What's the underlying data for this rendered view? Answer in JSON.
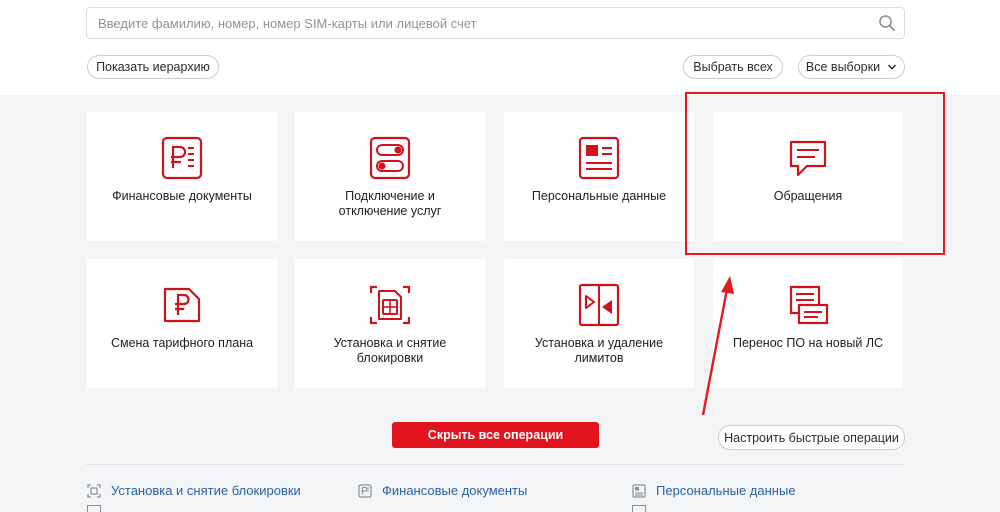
{
  "search": {
    "placeholder": "Введите фамилию, номер, номер SIM-карты или лицевой счет",
    "icon": "search-icon"
  },
  "buttons": {
    "show_hierarchy": "Показать иерархию",
    "select_all": "Выбрать всех",
    "all_selections": "Все выборки",
    "hide_all": "Скрыть все операции",
    "configure_quick": "Настроить быстрые операции"
  },
  "tiles": [
    {
      "label": "Финансовые документы",
      "icon": "ruble-document-icon"
    },
    {
      "label": "Подключение и\nотключение услуг",
      "icon": "toggle-switches-icon"
    },
    {
      "label": "Персональные данные",
      "icon": "personal-card-icon"
    },
    {
      "label": "Обращения",
      "icon": "chat-bubble-icon"
    },
    {
      "label": "Смена тарифного плана",
      "icon": "ruble-sim-icon"
    },
    {
      "label": "Установка и снятие\nблокировки",
      "icon": "sim-lock-icon"
    },
    {
      "label": "Установка и удаление\nлимитов",
      "icon": "limits-icon"
    },
    {
      "label": "Перенос ПО на новый ЛС",
      "icon": "transfer-icon"
    }
  ],
  "links": [
    {
      "label": "Установка и снятие блокировки",
      "icon": "sim-lock-icon"
    },
    {
      "label": "Финансовые документы",
      "icon": "ruble-document-icon"
    },
    {
      "label": "Персональные данные",
      "icon": "personal-card-icon"
    }
  ],
  "colors": {
    "accent": "#e1141e",
    "link": "#2b63a6",
    "background": "#f3f4f6"
  }
}
